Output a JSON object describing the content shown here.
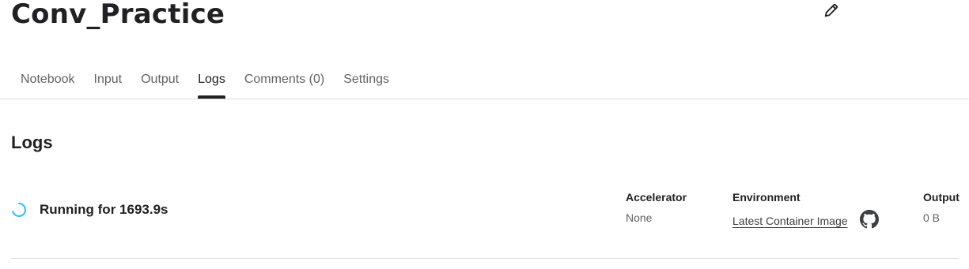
{
  "notebook": {
    "title": "Conv_Practice"
  },
  "tabs": [
    {
      "label": "Notebook"
    },
    {
      "label": "Input"
    },
    {
      "label": "Output"
    },
    {
      "label": "Logs",
      "active": true
    },
    {
      "label": "Comments (0)"
    },
    {
      "label": "Settings"
    }
  ],
  "logs": {
    "heading": "Logs",
    "status": "Running for 1693.9s",
    "accelerator": {
      "label": "Accelerator",
      "value": "None"
    },
    "environment": {
      "label": "Environment",
      "value": "Latest Container Image"
    },
    "output": {
      "label": "Output",
      "value": "0 B"
    }
  },
  "icons": {
    "edit": "pencil-icon",
    "status": "spinner-icon",
    "environment": "github-icon"
  },
  "colors": {
    "spinner": "#20beff",
    "text": "#202124",
    "muted": "#5f6368"
  }
}
